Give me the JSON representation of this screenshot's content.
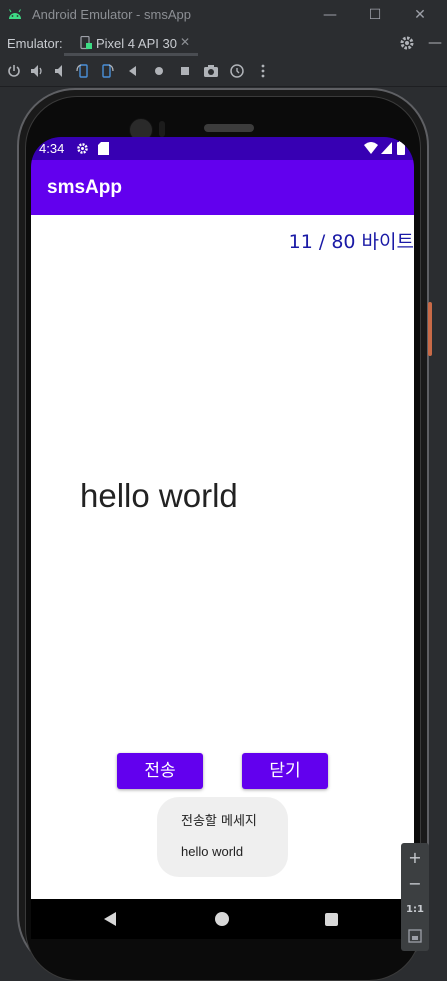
{
  "window": {
    "title": "Android Emulator - smsApp",
    "minimize": "—",
    "maximize": "☐",
    "close": "✕"
  },
  "emulator": {
    "label": "Emulator:",
    "device_tab": "Pixel 4 API 30",
    "tab_close": "✕"
  },
  "phone": {
    "status_time": "4:34",
    "app_title": "smsApp",
    "byte_counter": "11 / 80 바이트",
    "message_text": "hello world",
    "send_button": "전송",
    "close_button": "닫기",
    "toast": {
      "title": "전송할 메세지",
      "message": "hello world"
    }
  },
  "zoom": {
    "plus": "+",
    "minus": "−",
    "ratio": "1:1"
  },
  "colors": {
    "status_bar": "#3700b3",
    "app_bar": "#6200ee",
    "button": "#6200ee",
    "counter_text": "#1a1aa6"
  }
}
